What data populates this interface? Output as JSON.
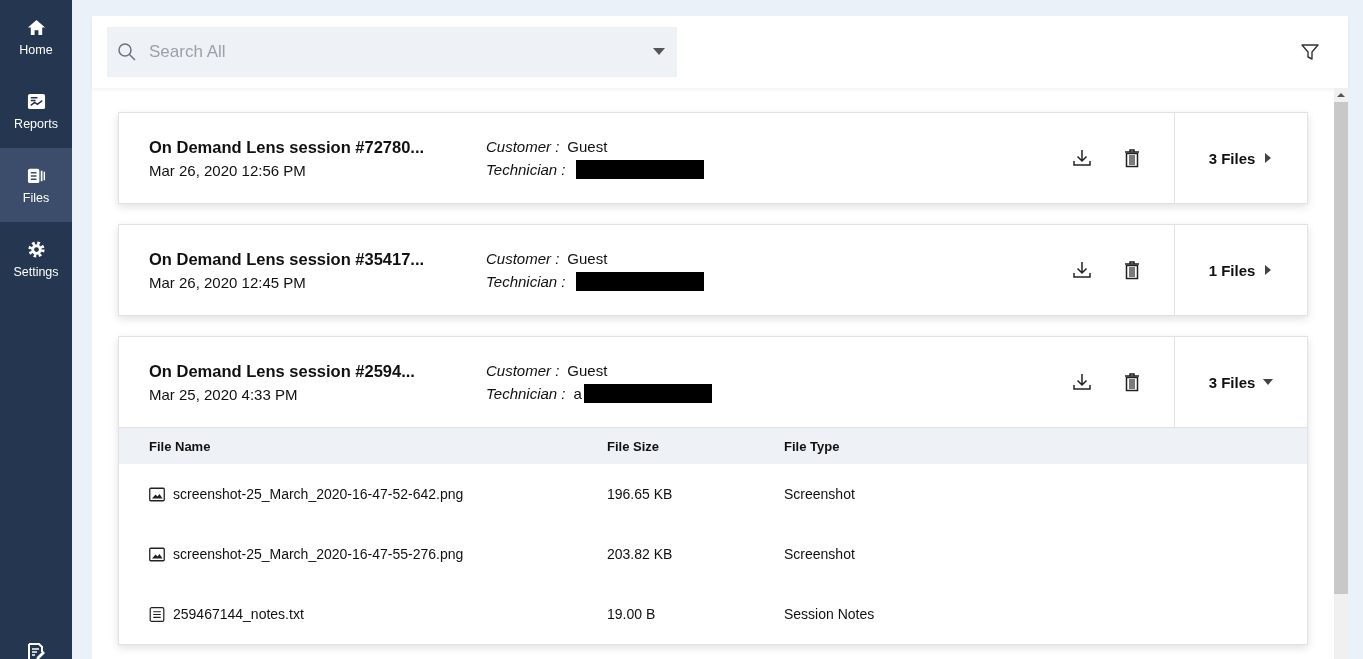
{
  "sidebar": {
    "items": [
      {
        "label": "Home",
        "kind": "home",
        "selected": false
      },
      {
        "label": "Reports",
        "kind": "reports",
        "selected": false
      },
      {
        "label": "Files",
        "kind": "files",
        "selected": true
      },
      {
        "label": "Settings",
        "kind": "settings",
        "selected": false
      }
    ]
  },
  "search": {
    "placeholder": "Search All"
  },
  "sessions": [
    {
      "title": "On Demand Lens session #72780...",
      "date": "Mar 26, 2020 12:56 PM",
      "customer_label": "Customer :",
      "customer": "Guest",
      "technician_label": "Technician :",
      "files_label": "3 Files",
      "expanded": false
    },
    {
      "title": "On Demand Lens session #35417...",
      "date": "Mar 26, 2020 12:45 PM",
      "customer_label": "Customer :",
      "customer": "Guest",
      "technician_label": "Technician :",
      "files_label": "1 Files",
      "expanded": false
    },
    {
      "title": "On Demand Lens session #2594...",
      "date": "Mar 25, 2020 4:33 PM",
      "customer_label": "Customer :",
      "customer": "Guest",
      "technician_label": "Technician :",
      "technician": "a",
      "files_label": "3 Files",
      "expanded": true,
      "table": {
        "columns": [
          "File Name",
          "File Size",
          "File Type"
        ],
        "rows": [
          {
            "kind": "image",
            "name": "screenshot-25_March_2020-16-47-52-642.png",
            "size": "196.65 KB",
            "type": "Screenshot"
          },
          {
            "kind": "image",
            "name": "screenshot-25_March_2020-16-47-55-276.png",
            "size": "203.82 KB",
            "type": "Screenshot"
          },
          {
            "kind": "text",
            "name": "259467144_notes.txt",
            "size": "19.00 B",
            "type": "Session Notes"
          }
        ]
      }
    }
  ]
}
